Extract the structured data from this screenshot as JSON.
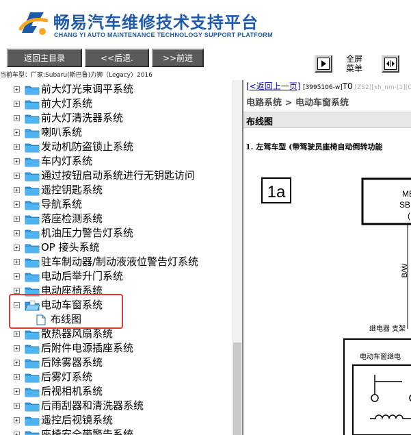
{
  "header": {
    "title_cn": "畅易汽车维修技术支持平台",
    "title_en": "CHANG YI AUTO MAINTENANCE TECHNOLOGY SUPPORT PLATFORM",
    "brand_color": "#1f5aa8"
  },
  "toolbar": {
    "home_label": "返回主目录",
    "back_label": "<<后退.",
    "forward_label": ">>前进",
    "fullscreen_label": "全屏菜单"
  },
  "vehicle": {
    "text": "当前车型：厂家:Subaru(斯巴鲁)力狮（Legacy）2016"
  },
  "tree": {
    "items": [
      {
        "label": "前大灯光束调平系统"
      },
      {
        "label": "前大灯系统"
      },
      {
        "label": "前大灯清洗器系统"
      },
      {
        "label": "喇叭系统"
      },
      {
        "label": "发动机防盗锁止系统"
      },
      {
        "label": "车内灯系统"
      },
      {
        "label": "通过按钮启动系统进行无钥匙访问"
      },
      {
        "label": "遥控钥匙系统"
      },
      {
        "label": "导航系统"
      },
      {
        "label": "落座检测系统"
      },
      {
        "label": "机油压力警告灯系统"
      },
      {
        "label": "OP 接头系统"
      },
      {
        "label": "驻车制动器/制动液液位警告灯系统"
      },
      {
        "label": "电动后举升门系统"
      },
      {
        "label": "电动座椅系统"
      },
      {
        "label": "电动车窗系统"
      },
      {
        "label": "布线图"
      },
      {
        "label": "散热器风扇系统"
      },
      {
        "label": "后附件电源插座系统"
      },
      {
        "label": "后除雾器系统"
      },
      {
        "label": "后雾灯系统"
      },
      {
        "label": "后视相机系统"
      },
      {
        "label": "后雨刮器和清洗器系统"
      },
      {
        "label": "遥控后视镜系统"
      },
      {
        "label": "座椅安全带警告系统"
      }
    ]
  },
  "content": {
    "back_link": "[<返回上一页]",
    "meta_id": "[3995106-w]",
    "meta_t0": "T0",
    "meta_dim": "[ZS2][xh_nm-[1][CX-0",
    "breadcrumb": "电路系统 > 电动车窗系统",
    "section_title": "布线图",
    "diagram_heading": "1. 左驾车型 (带驾驶员座椅自动倒转功能",
    "diagram": {
      "box_label": "1a",
      "module_line1": "ME",
      "module_line2": "SB",
      "module_line3": "(",
      "wire_label": "B/W",
      "relay_caption": "继电器 支架",
      "relay_title": "电动车窗继电"
    }
  }
}
